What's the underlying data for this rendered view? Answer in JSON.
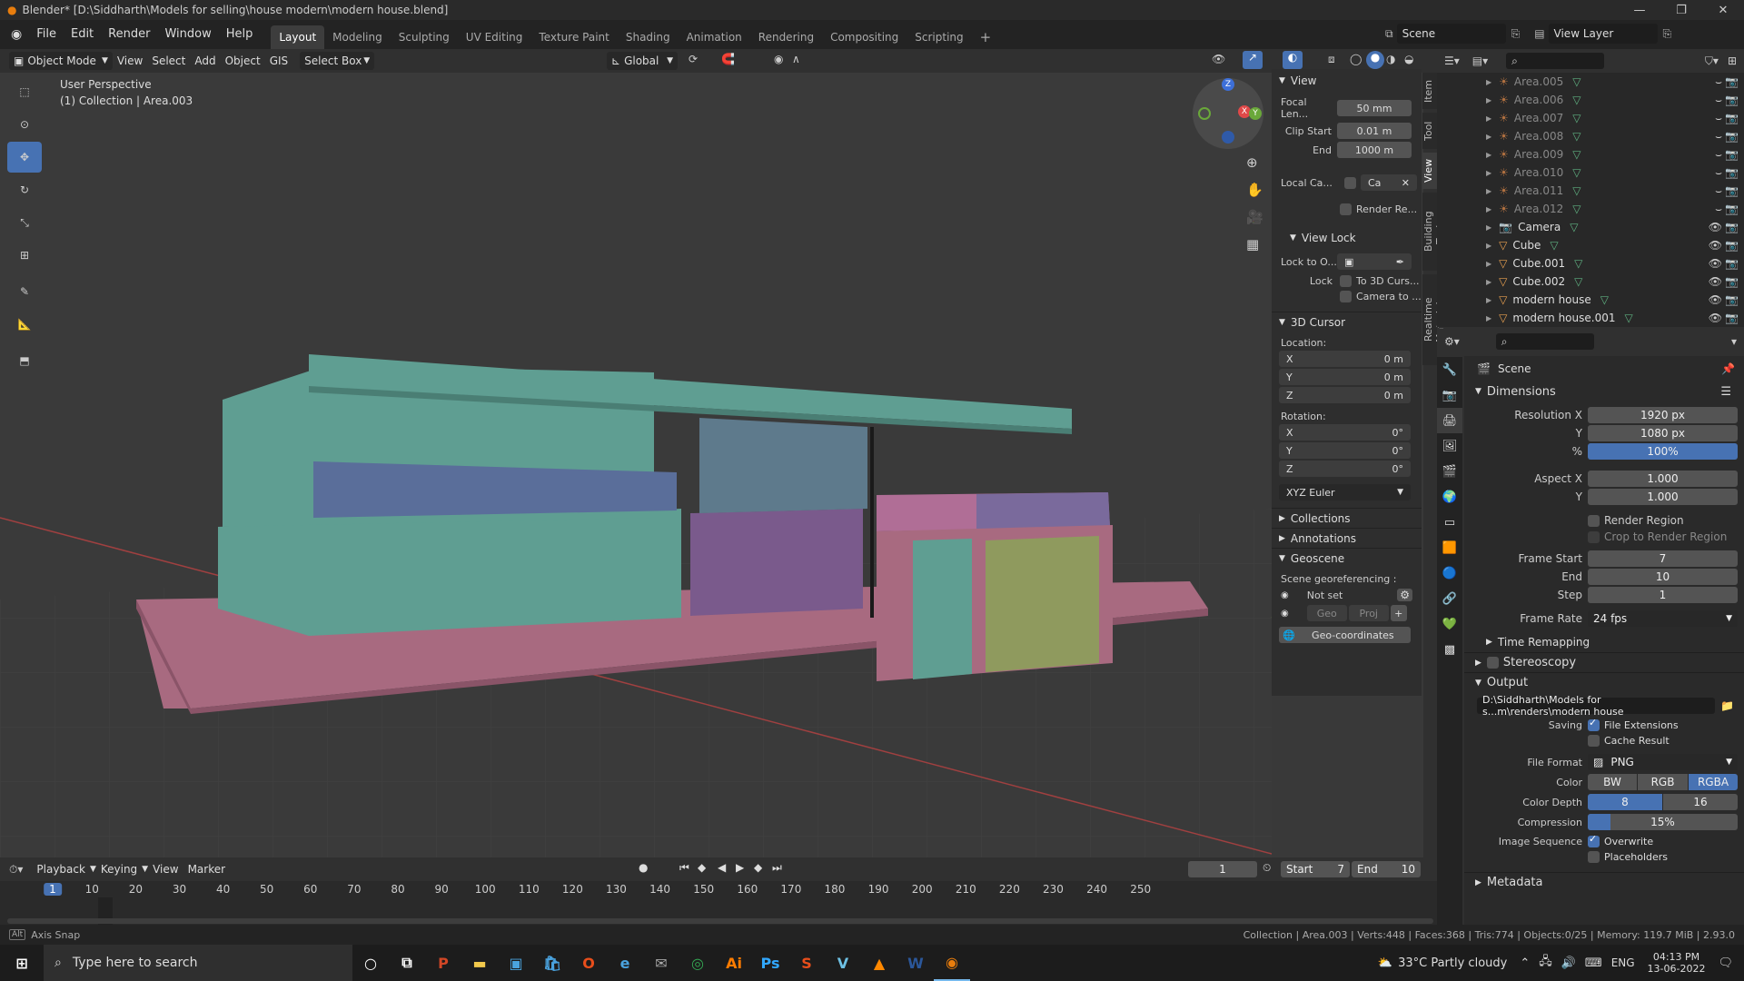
{
  "window": {
    "title": "Blender* [D:\\Siddharth\\Models for selling\\house modern\\modern house.blend]"
  },
  "menus": [
    "File",
    "Edit",
    "Render",
    "Window",
    "Help"
  ],
  "workspaces": [
    "Layout",
    "Modeling",
    "Sculpting",
    "UV Editing",
    "Texture Paint",
    "Shading",
    "Animation",
    "Rendering",
    "Compositing",
    "Scripting"
  ],
  "active_workspace": "Layout",
  "scene": {
    "label": "Scene",
    "view_layer": "View Layer"
  },
  "viewport_header": {
    "mode": "Object Mode",
    "view": "View",
    "select": "Select",
    "add": "Add",
    "object": "Object",
    "gis": "GIS",
    "select_box": "Select Box",
    "orientation": "Global"
  },
  "viewport": {
    "perspective": "User Perspective",
    "collection": "(1) Collection | Area.003",
    "gizmo": {
      "z": "Z",
      "x": "X",
      "y": "Y"
    }
  },
  "npanel": {
    "view_header": "View",
    "focal_label": "Focal Len...",
    "focal_value": "50 mm",
    "clip_start_label": "Clip Start",
    "clip_start_value": "0.01 m",
    "end_label": "End",
    "end_value": "1000 m",
    "local_camera_label": "Local Ca...",
    "local_camera_value": "Ca",
    "render_region": "Render Re...",
    "view_lock_header": "View Lock",
    "lock_to_label": "Lock to O...",
    "lock_label": "Lock",
    "lock_cursor": "To 3D Curs...",
    "lock_camera": "Camera to ...",
    "cursor_header": "3D Cursor",
    "location_label": "Location:",
    "loc_x": "0 m",
    "loc_y": "0 m",
    "loc_z": "0 m",
    "rotation_label": "Rotation:",
    "rot_x": "0°",
    "rot_y": "0°",
    "rot_z": "0°",
    "axis_x": "X",
    "axis_y": "Y",
    "axis_z": "Z",
    "euler": "XYZ Euler",
    "collections": "Collections",
    "annotations": "Annotations",
    "geoscene": "Geoscene",
    "georef": "Scene georeferencing :",
    "not_set": "Not set",
    "geo": "Geo",
    "proj": "Proj",
    "geo_coords": "Geo-coordinates",
    "tabs": [
      "Item",
      "Tool",
      "View",
      "Building Tools",
      "Realtime Materials"
    ]
  },
  "outliner": {
    "items": [
      {
        "name": "Area.005",
        "dim": true
      },
      {
        "name": "Area.006",
        "dim": true
      },
      {
        "name": "Area.007",
        "dim": true
      },
      {
        "name": "Area.008",
        "dim": true
      },
      {
        "name": "Area.009",
        "dim": true
      },
      {
        "name": "Area.010",
        "dim": true
      },
      {
        "name": "Area.011",
        "dim": true
      },
      {
        "name": "Area.012",
        "dim": true
      },
      {
        "name": "Camera",
        "dim": false
      },
      {
        "name": "Cube",
        "dim": false
      },
      {
        "name": "Cube.001",
        "dim": false
      },
      {
        "name": "Cube.002",
        "dim": false
      },
      {
        "name": "modern house",
        "dim": false
      },
      {
        "name": "modern house.001",
        "dim": false
      }
    ]
  },
  "properties": {
    "scene_label": "Scene",
    "dimensions": "Dimensions",
    "res_x_label": "Resolution X",
    "res_x": "1920 px",
    "res_y_label": "Y",
    "res_y": "1080 px",
    "res_pct_label": "%",
    "res_pct": "100%",
    "aspect_x_label": "Aspect X",
    "aspect_x": "1.000",
    "aspect_y_label": "Y",
    "aspect_y": "1.000",
    "render_region": "Render Region",
    "crop": "Crop to Render Region",
    "frame_start_label": "Frame Start",
    "frame_start": "7",
    "end_label": "End",
    "end": "10",
    "step_label": "Step",
    "step": "1",
    "frame_rate_label": "Frame Rate",
    "frame_rate": "24 fps",
    "time_remapping": "Time Remapping",
    "stereoscopy": "Stereoscopy",
    "output": "Output",
    "output_path": "D:\\Siddharth\\Models for s...m\\renders\\modern house",
    "saving_label": "Saving",
    "file_ext": "File Extensions",
    "cache": "Cache Result",
    "file_format_label": "File Format",
    "file_format": "PNG",
    "color_label": "Color",
    "color_opts": [
      "BW",
      "RGB",
      "RGBA"
    ],
    "depth_label": "Color Depth",
    "depth_opts": [
      "8",
      "16"
    ],
    "compression_label": "Compression",
    "compression": "15%",
    "image_seq_label": "Image Sequence",
    "overwrite": "Overwrite",
    "placeholders": "Placeholders",
    "metadata": "Metadata"
  },
  "timeline": {
    "playback": "Playback",
    "keying": "Keying",
    "view": "View",
    "marker": "Marker",
    "current": "1",
    "start_label": "Start",
    "start": "7",
    "end_label": "End",
    "end": "10",
    "ticks": [
      "1",
      "10",
      "20",
      "30",
      "40",
      "50",
      "60",
      "70",
      "80",
      "90",
      "100",
      "110",
      "120",
      "130",
      "140",
      "150",
      "160",
      "170",
      "180",
      "190",
      "200",
      "210",
      "220",
      "230",
      "240",
      "250"
    ]
  },
  "status": {
    "left": "Axis Snap",
    "right": "Collection | Area.003 | Verts:448 | Faces:368 | Tris:774 | Objects:0/25 | Memory: 119.7 MiB | 2.93.0"
  },
  "taskbar": {
    "search": "Type here to search",
    "weather": "33°C  Partly cloudy",
    "lang": "ENG",
    "time": "04:13 PM",
    "date": "13-06-2022"
  },
  "colors": {
    "accent": "#4772b3",
    "house_green": "#5f9e92",
    "base_pink": "#a86a80"
  }
}
